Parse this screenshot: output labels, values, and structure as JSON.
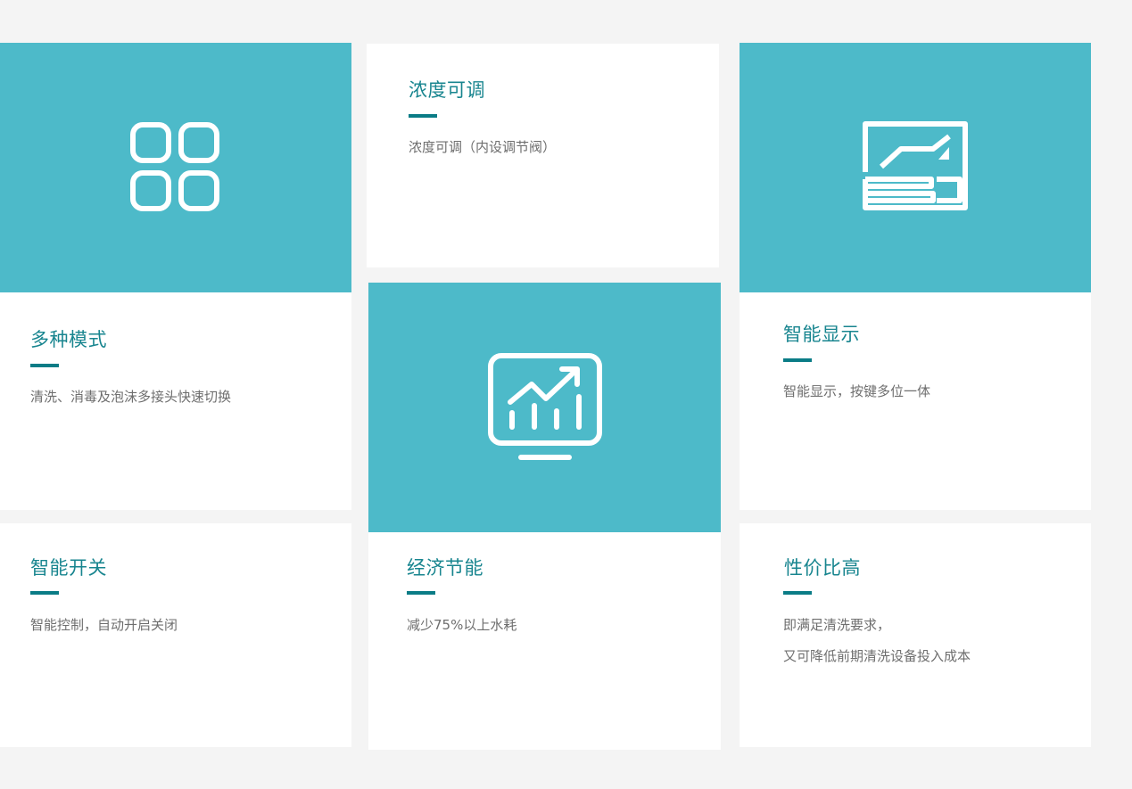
{
  "colors": {
    "page_bg": "#f4f4f4",
    "card_bg": "#ffffff",
    "accent_block": "#4dbac9",
    "title": "#18858f",
    "underline": "#0a7c86",
    "body_text": "#6e6e6e"
  },
  "features": [
    {
      "id": "multi-mode",
      "title": "多种模式",
      "lines": [
        "清洗、消毒及泡沫多接头快速切换"
      ],
      "icon": "grid-four-squares-icon"
    },
    {
      "id": "concentration",
      "title": "浓度可调",
      "lines": [
        "浓度可调（内设调节阀）"
      ]
    },
    {
      "id": "smart-display",
      "title": "智能显示",
      "lines": [
        "智能显示，按键多位一体"
      ],
      "icon": "display-panel-icon"
    },
    {
      "id": "smart-switch",
      "title": "智能开关",
      "lines": [
        "智能控制，自动开启关闭"
      ]
    },
    {
      "id": "energy-saving",
      "title": "经济节能",
      "lines": [
        "减少75%以上水耗"
      ],
      "icon": "monitor-chart-icon"
    },
    {
      "id": "value",
      "title": "性价比高",
      "lines": [
        "即满足清洗要求，",
        "又可降低前期清洗设备投入成本"
      ]
    }
  ]
}
